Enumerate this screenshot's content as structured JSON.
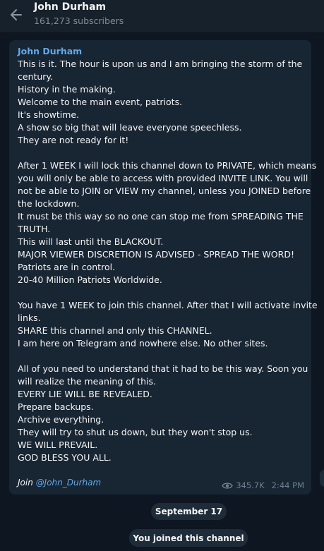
{
  "header": {
    "title": "John Durham",
    "subtitle": "161,273 subscribers",
    "back_icon": "arrow-left-icon"
  },
  "post": {
    "author": "John Durham",
    "lines": [
      "This is it. The hour is upon us and I am bringing the storm of the",
      "century.",
      "History in the making.",
      "Welcome to the main event, patriots.",
      "It's showtime.",
      "A show so big that will leave everyone speechless.",
      "They are not ready for it!",
      "",
      "After 1 WEEK I will lock this channel down to PRIVATE, which means",
      "you will only be able to access with provided INVITE LINK. You will",
      "not be able to JOIN or VIEW my channel, unless you JOINED before",
      "the lockdown.",
      "It must be this way so no one can stop me from SPREADING THE",
      "TRUTH.",
      "This will last until the BLACKOUT.",
      "MAJOR VIEWER DISCRETION IS ADVISED - SPREAD THE WORD!",
      "Patriots are in control.",
      "20-40 Million Patriots Worldwide.",
      "",
      "You have 1 WEEK to join this channel. After that I will activate invite",
      "links.",
      "SHARE this channel and only this CHANNEL.",
      "I am here on Telegram and nowhere else. No other sites.",
      "",
      "All of you need to understand that it had to be this way. Soon you",
      "will realize the meaning of this.",
      "EVERY LIE WILL BE REVEALED.",
      "Prepare backups.",
      "Archive everything.",
      "They will try to shut us down, but they won't stop us.",
      "WE WILL PREVAIL.",
      "GOD BLESS YOU ALL."
    ],
    "join_prefix": "Join",
    "join_link": "@John_Durham",
    "views": "345.7K",
    "time": "2:44 PM",
    "views_icon": "eye-icon"
  },
  "service": {
    "date": "September 17",
    "joined": "You joined this channel"
  },
  "colors": {
    "background": "#0e1621",
    "header": "#17212b",
    "bubble": "#182533",
    "accent": "#62a8ea",
    "meta": "#6d7f8f"
  }
}
